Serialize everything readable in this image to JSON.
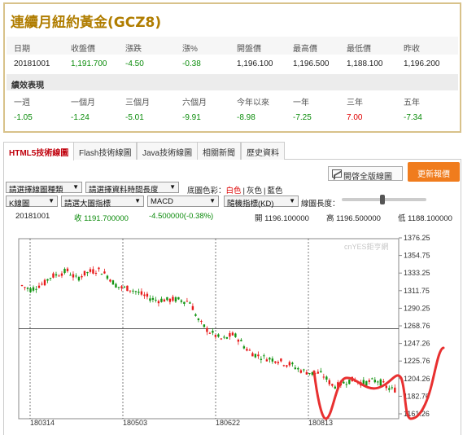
{
  "quote": {
    "title": "連續月紐約黃金(GCZ8)",
    "headers": [
      "日期",
      "收盤價",
      "漲跌",
      "漲%",
      "開盤價",
      "最高價",
      "最低價",
      "昨收"
    ],
    "values": [
      "20181001",
      "1,191.700",
      "-4.50",
      "-0.38",
      "1,196.100",
      "1,196.500",
      "1,188.100",
      "1,196.200"
    ],
    "perf_title": "績效表現",
    "perf_headers": [
      "一週",
      "一個月",
      "三個月",
      "六個月",
      "今年以來",
      "一年",
      "三年",
      "五年"
    ],
    "perf_values": [
      "-1.05",
      "-1.24",
      "-5.01",
      "-9.91",
      "-8.98",
      "-7.25",
      "7.00",
      "-7.34"
    ]
  },
  "tabs": [
    "HTML5技術線圖",
    "Flash技術線圖",
    "Java技術線圖",
    "相關新聞",
    "歷史資料"
  ],
  "toolbar": {
    "fullscreen_label": "開啓全版線圖",
    "refresh_label": "更新報價",
    "chart_type_select": "請選擇線圖種類",
    "period_select": "請選擇資料時間長度",
    "bg_label": "底圖色彩：",
    "bg_white": "白色",
    "bg_sep1": "|",
    "bg_gray": "灰色",
    "bg_sep2": "|",
    "bg_blue": "藍色",
    "kline_select": "K線圖",
    "indicator_select": "請選大圖指標",
    "macd_select": "MACD",
    "random_select": "隨機指標(KD)",
    "length_label": "線圖長度："
  },
  "info": {
    "date": "20181001",
    "close": "收 1191.700000",
    "change": "-4.500000(-0.38%)",
    "open": "開 1196.100000",
    "high": "高 1196.500000",
    "low": "低 1188.100000"
  },
  "chart_data": {
    "type": "candlestick",
    "watermark": "cnYES鉅亨網",
    "y_ticks": [
      "1376.25",
      "1354.75",
      "1333.25",
      "1311.75",
      "1290.25",
      "1268.76",
      "1247.26",
      "1225.76",
      "1204.26",
      "1182.76",
      "1161.26"
    ],
    "x_ticks": [
      "180314",
      "180503",
      "180622",
      "180813"
    ],
    "ylim": [
      1161.26,
      1376.25
    ],
    "close_trend": [
      1318,
      1315,
      1313,
      1316,
      1319,
      1321,
      1328,
      1330,
      1332,
      1334,
      1336,
      1331,
      1326,
      1330,
      1333,
      1335,
      1336,
      1337,
      1333,
      1329,
      1322,
      1317,
      1315,
      1315,
      1313,
      1311,
      1308,
      1305,
      1303,
      1301,
      1300,
      1301,
      1300,
      1301,
      1301,
      1300,
      1299,
      1298,
      1284,
      1273,
      1268,
      1262,
      1259,
      1255,
      1252,
      1254,
      1258,
      1256,
      1250,
      1242,
      1238,
      1234,
      1232,
      1230,
      1229,
      1228,
      1227,
      1225,
      1222,
      1222,
      1218,
      1215,
      1213,
      1212,
      1210,
      1211,
      1209,
      1203,
      1197,
      1195,
      1198,
      1200,
      1202,
      1203,
      1200,
      1199,
      1200,
      1201,
      1202,
      1199,
      1194,
      1191
    ]
  }
}
